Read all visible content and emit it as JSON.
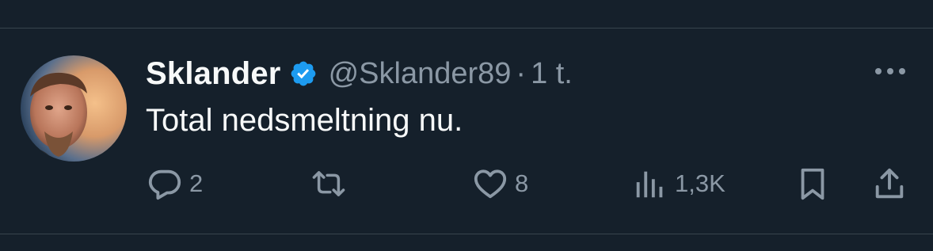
{
  "tweet": {
    "display_name": "Sklander",
    "handle": "@Sklander89",
    "separator": "·",
    "time": "1 t.",
    "text": "Total nedsmeltning nu."
  },
  "actions": {
    "replies": "2",
    "retweets": "",
    "likes": "8",
    "views": "1,3K"
  },
  "icons": {
    "verified": "verified-badge-icon",
    "more": "more-dots-icon",
    "reply": "reply-icon",
    "retweet": "retweet-icon",
    "like": "heart-icon",
    "views": "views-chart-icon",
    "bookmark": "bookmark-icon",
    "share": "share-icon"
  },
  "colors": {
    "background": "#15202b",
    "text_primary": "#f7f9f9",
    "text_secondary": "#8b98a5",
    "verified": "#1d9bf0",
    "divider": "#38444d"
  }
}
